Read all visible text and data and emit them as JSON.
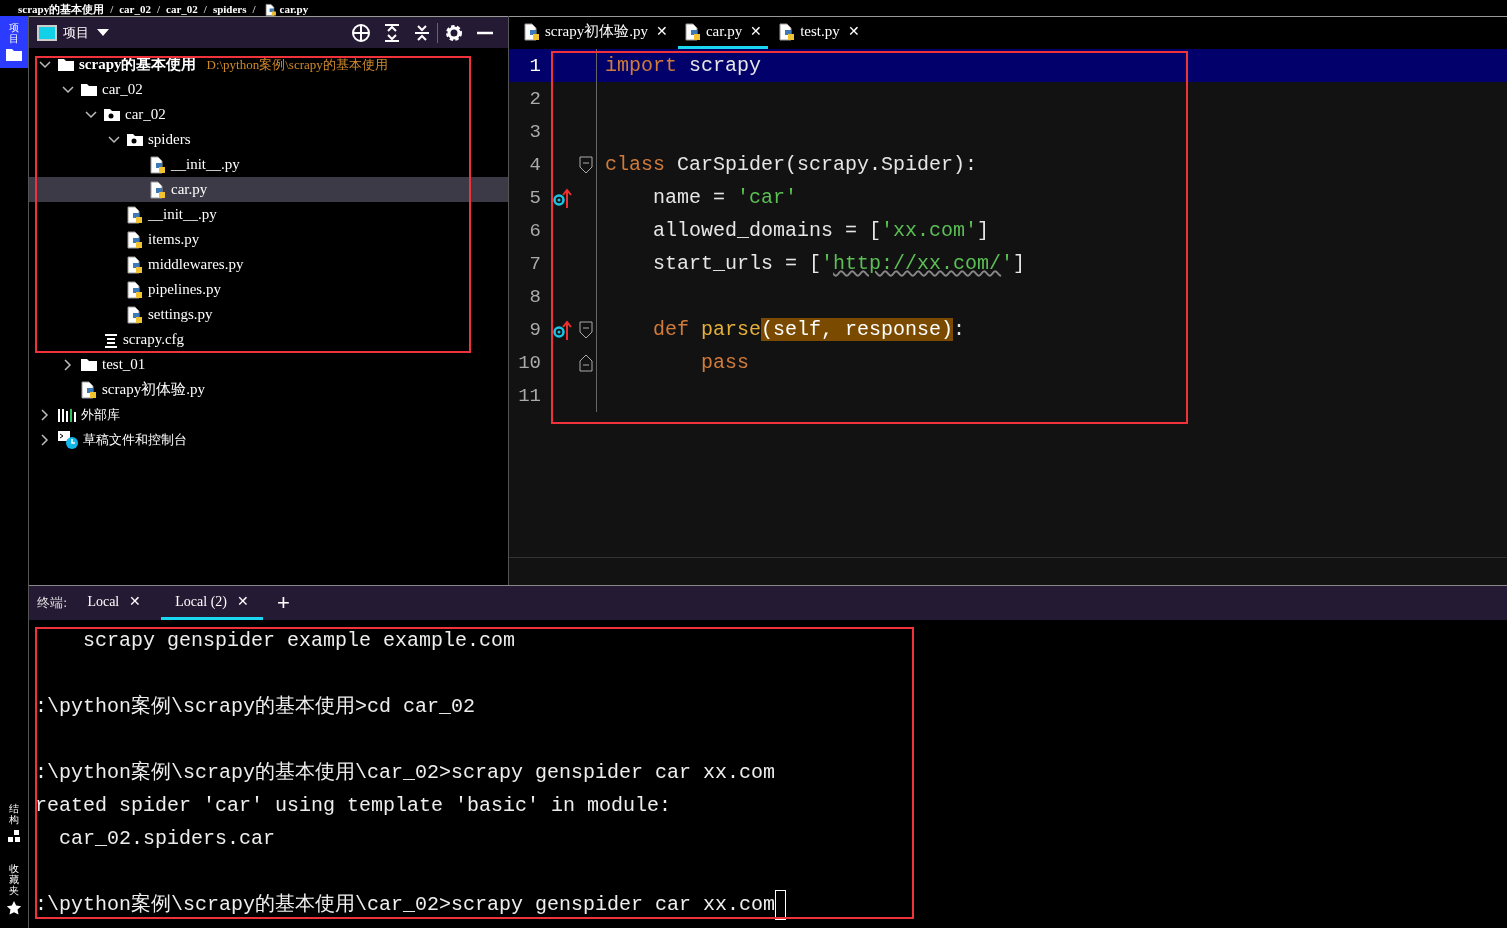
{
  "breadcrumb": [
    {
      "text": "scrapy的基本使用",
      "kind": "folder"
    },
    {
      "text": "/",
      "kind": "separator"
    },
    {
      "text": "car_02",
      "kind": "folder"
    },
    {
      "text": "/",
      "kind": "separator"
    },
    {
      "text": "car_02",
      "kind": "folder"
    },
    {
      "text": "/",
      "kind": "separator"
    },
    {
      "text": "spiders",
      "kind": "folder"
    },
    {
      "text": "/",
      "kind": "separator"
    },
    {
      "text": "car.py",
      "kind": "python"
    }
  ],
  "side_tools": [
    {
      "label": "项目",
      "selected": true
    },
    {
      "label": "结构",
      "selected": false
    },
    {
      "label": "收藏夹",
      "selected": false
    }
  ],
  "project_panel": {
    "title": "项目",
    "tree": [
      {
        "name": "scrapy的基本使用",
        "path": "D:\\python案例\\scrapy的基本使用",
        "kind": "folder",
        "expanded": true,
        "selected": false,
        "children": [
          {
            "name": "car_02",
            "kind": "folder",
            "expanded": true,
            "selected": false,
            "children": [
              {
                "name": "car_02",
                "kind": "package",
                "expanded": true,
                "selected": false,
                "children": [
                  {
                    "name": "spiders",
                    "kind": "package",
                    "expanded": true,
                    "selected": false,
                    "children": [
                      {
                        "name": "__init__.py",
                        "kind": "python",
                        "selected": false
                      },
                      {
                        "name": "car.py",
                        "kind": "python",
                        "selected": true
                      }
                    ]
                  },
                  {
                    "name": "__init__.py",
                    "kind": "python",
                    "selected": false
                  },
                  {
                    "name": "items.py",
                    "kind": "python",
                    "selected": false
                  },
                  {
                    "name": "middlewares.py",
                    "kind": "python",
                    "selected": false
                  },
                  {
                    "name": "pipelines.py",
                    "kind": "python",
                    "selected": false
                  },
                  {
                    "name": "settings.py",
                    "kind": "python",
                    "selected": false
                  }
                ]
              },
              {
                "name": "scrapy.cfg",
                "kind": "config",
                "selected": false
              }
            ]
          },
          {
            "name": "test_01",
            "kind": "folder",
            "expanded": false,
            "selected": false
          },
          {
            "name": "scrapy初体验.py",
            "kind": "python",
            "selected": false
          }
        ]
      },
      {
        "name": "外部库",
        "kind": "library",
        "expanded": false,
        "selected": false
      },
      {
        "name": "草稿文件和控制台",
        "kind": "scratch",
        "expanded": false,
        "selected": false
      }
    ]
  },
  "editor": {
    "tabs": [
      {
        "label": "scrapy初体验.py",
        "close": "✕",
        "selected": false
      },
      {
        "label": "car.py",
        "close": "✕",
        "selected": true
      },
      {
        "label": "test.py",
        "close": "✕",
        "selected": false
      }
    ],
    "lines": [
      {
        "number": "1",
        "current": true,
        "tokens": [
          {
            "t": "import",
            "kind": "keyword"
          },
          {
            "t": " scrapy",
            "kind": "plain"
          }
        ]
      },
      {
        "number": "2",
        "current": false
      },
      {
        "number": "3",
        "current": false
      },
      {
        "number": "4",
        "current": false,
        "fold_open": true,
        "tokens": [
          {
            "t": "class",
            "kind": "keyword"
          },
          {
            "t": " CarSpider(scrapy.Spider):",
            "kind": "plain"
          }
        ]
      },
      {
        "number": "5",
        "current": false,
        "override": true,
        "tokens": [
          {
            "t": "    name = ",
            "kind": "plain"
          },
          {
            "t": "'car'",
            "kind": "string"
          }
        ]
      },
      {
        "number": "6",
        "current": false,
        "tokens": [
          {
            "t": "    allowed_domains = [",
            "kind": "plain"
          },
          {
            "t": "'xx.com'",
            "kind": "string"
          },
          {
            "t": "]",
            "kind": "plain"
          }
        ]
      },
      {
        "number": "7",
        "current": false,
        "tokens": [
          {
            "t": "    start_urls = [",
            "kind": "plain"
          },
          {
            "t": "'",
            "kind": "string"
          },
          {
            "t": "http://xx.com/",
            "kind": "url"
          },
          {
            "t": "'",
            "kind": "string"
          },
          {
            "t": "]",
            "kind": "plain"
          }
        ]
      },
      {
        "number": "8",
        "current": false
      },
      {
        "number": "9",
        "current": false,
        "override": true,
        "fold_open": true,
        "tokens": [
          {
            "t": "    def ",
            "kind": "keyword"
          },
          {
            "t": "parse",
            "kind": "function"
          },
          {
            "t": "(self, response)",
            "kind": "match"
          },
          {
            "t": ":",
            "kind": "plain"
          }
        ]
      },
      {
        "number": "10",
        "current": false,
        "fold_close": true,
        "tokens": [
          {
            "t": "        pass",
            "kind": "keyword"
          }
        ]
      },
      {
        "number": "11",
        "current": false
      }
    ]
  },
  "terminal": {
    "label": "终端:",
    "tabs": [
      {
        "label": "Local",
        "close": "✕",
        "selected": false
      },
      {
        "label": "Local (2)",
        "close": "✕",
        "selected": true
      }
    ],
    "add": "+",
    "blocks": [
      [
        "    scrapy genspider example example.com"
      ],
      [
        ":\\python案例\\scrapy的基本使用>cd car_02"
      ],
      [
        ":\\python案例\\scrapy的基本使用\\car_02>scrapy genspider car xx.com",
        "reated spider 'car' using template 'basic' in module:",
        "  car_02.spiders.car"
      ],
      [
        ":\\python案例\\scrapy的基本使用\\car_02>scrapy genspider car xx.com"
      ]
    ]
  }
}
